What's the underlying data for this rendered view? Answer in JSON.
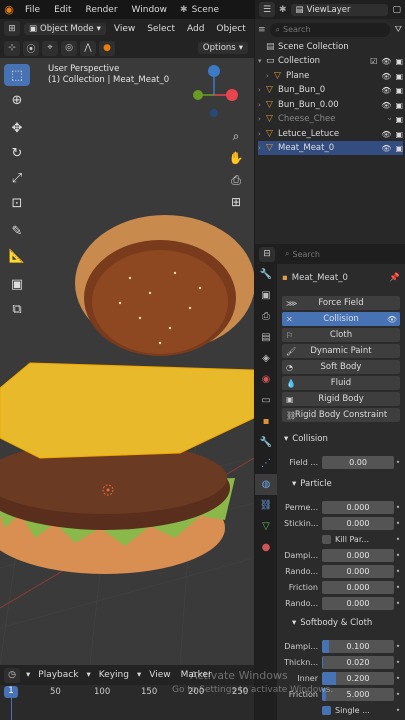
{
  "menubar": {
    "items": [
      "File",
      "Edit",
      "Render",
      "Window"
    ],
    "scene_label": "Scene",
    "viewlayer_label": "ViewLayer"
  },
  "viewport": {
    "mode": "Object Mode",
    "menu": [
      "View",
      "Select",
      "Add",
      "Object"
    ],
    "options_label": "Options",
    "perspective_label": "User Perspective",
    "collection_label": "(1) Collection | Meat_Meat_0",
    "gizmo": {
      "x": "X",
      "y": "Y",
      "z": "Z"
    },
    "colors": {
      "bun_top": "#c98a4e",
      "cheese": "#e8b92a",
      "patty": "#5a2e1c",
      "lettuce": "#8ab84a",
      "grid": "#3a3a3a"
    }
  },
  "outliner": {
    "search_placeholder": "Search",
    "rows": [
      {
        "name": "Scene Collection",
        "icon": "scene-collection-icon",
        "selected": false
      },
      {
        "name": "Collection",
        "icon": "collection-icon",
        "selected": false
      },
      {
        "name": "Plane",
        "icon": "mesh-icon",
        "selected": false
      },
      {
        "name": "Bun_Bun_0",
        "icon": "mesh-icon",
        "selected": false
      },
      {
        "name": "Bun_Bun_0.00",
        "icon": "mesh-icon",
        "selected": false
      },
      {
        "name": "Cheese_Chee",
        "icon": "mesh-icon",
        "selected": false
      },
      {
        "name": "Letuce_Letuce",
        "icon": "mesh-icon",
        "selected": false
      },
      {
        "name": "Meat_Meat_0",
        "icon": "mesh-icon",
        "selected": true
      }
    ]
  },
  "properties": {
    "search_placeholder": "Search",
    "object_name": "Meat_Meat_0",
    "physics_buttons": [
      "Force Field",
      "Collision",
      "Cloth",
      "Dynamic Paint",
      "Soft Body",
      "Fluid",
      "Rigid Body",
      "Rigid Body Constraint"
    ],
    "collision_section": "Collision",
    "field_label": "Field ...",
    "field_value": "0.00",
    "particle_section": "Particle",
    "particle_fields": [
      {
        "label": "Perme...",
        "value": "0.000"
      },
      {
        "label": "Stickin...",
        "value": "0.000"
      }
    ],
    "kill_label": "Kill Par...",
    "damping_fields": [
      {
        "label": "Dampi...",
        "value": "0.000"
      },
      {
        "label": "Rando...",
        "value": "0.000"
      },
      {
        "label": "Friction",
        "value": "0.000"
      },
      {
        "label": "Rando...",
        "value": "0.000"
      }
    ],
    "softbody_section": "Softbody & Cloth",
    "softbody_fields": [
      {
        "label": "Dampi...",
        "value": "0.100",
        "fill": 0.1
      },
      {
        "label": "Thickn...",
        "value": "0.020",
        "fill": 0.02
      },
      {
        "label": "Inner",
        "value": "0.200",
        "fill": 0.2
      },
      {
        "label": "Friction",
        "value": "5.000",
        "fill": 0.062
      }
    ],
    "single_label": "Single ..."
  },
  "timeline": {
    "menu": [
      "Playback",
      "Keying",
      "View",
      "Marker"
    ],
    "frame_numbers": [
      "1",
      "50",
      "100",
      "150",
      "200",
      "250"
    ],
    "current_frame": "1"
  },
  "watermark": {
    "line1": "Activate Windows",
    "line2": "Go to Settings to activate Windows."
  }
}
